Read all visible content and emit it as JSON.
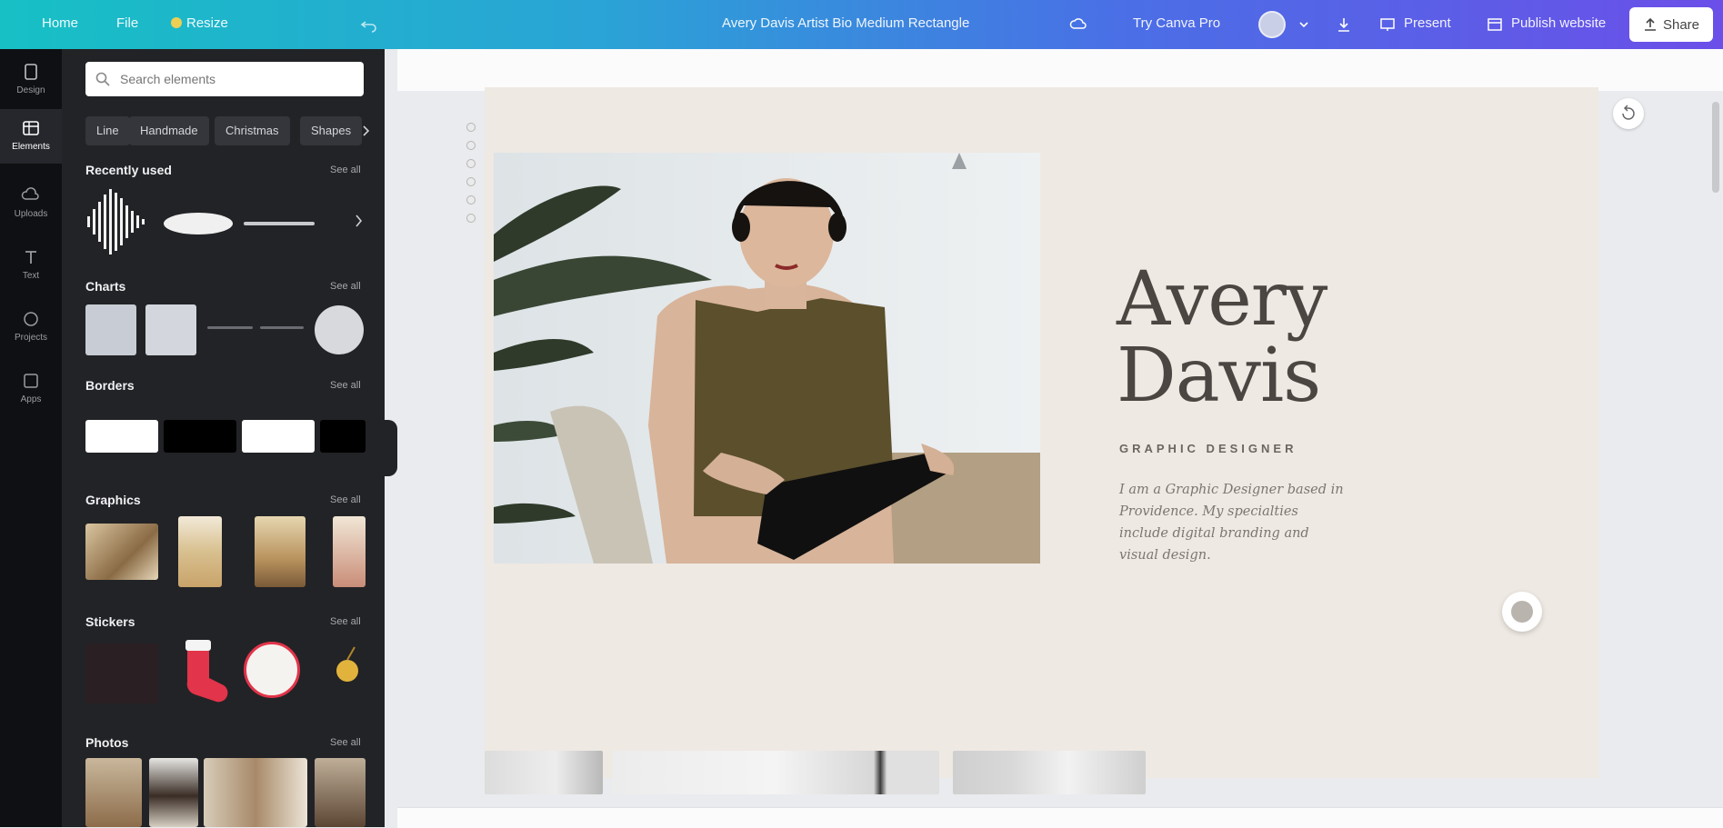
{
  "topbar": {
    "home": "Home",
    "file": "File",
    "resize": "Resize",
    "doc_title": "Avery Davis Artist Bio Medium Rectangle",
    "try_pro": "Try Canva Pro",
    "present": "Present",
    "publish": "Publish website",
    "share": "Share"
  },
  "rail": {
    "items": [
      {
        "label": "Design"
      },
      {
        "label": "Elements"
      },
      {
        "label": "Uploads"
      },
      {
        "label": "Text"
      },
      {
        "label": "Projects"
      },
      {
        "label": "Apps"
      }
    ]
  },
  "panel": {
    "search_placeholder": "Search elements",
    "chips": [
      "Line",
      "Handmade",
      "Christmas",
      "Shapes"
    ],
    "sections": {
      "recently_used": "Recently used",
      "charts": "Charts",
      "borders": "Borders",
      "graphics": "Graphics",
      "stickers": "Stickers",
      "photos": "Photos"
    },
    "see_all": "See all"
  },
  "design": {
    "name_line1": "Avery",
    "name_line2": "Davis",
    "role": "GRAPHIC DESIGNER",
    "bio": "I am a Graphic Designer based in Providence. My specialties include digital branding and visual design."
  },
  "colors": {
    "accent": "#4a6fe6",
    "panel_bg": "#222326",
    "page_bg": "#efe9e3",
    "name_color": "#4b4642"
  }
}
